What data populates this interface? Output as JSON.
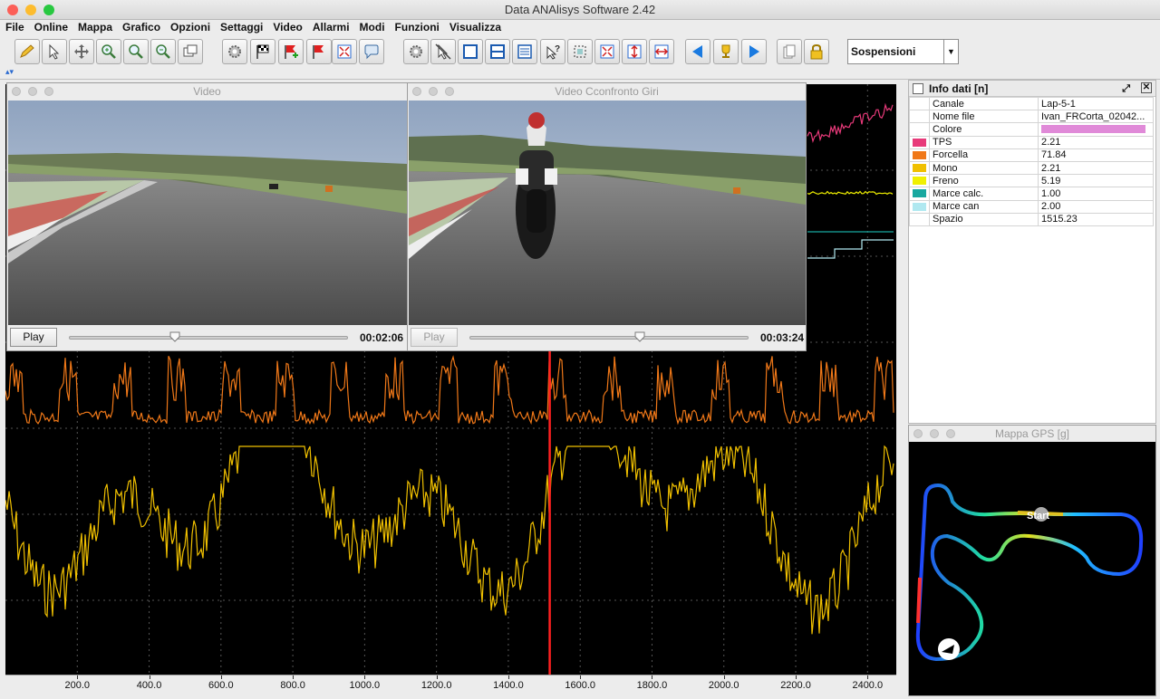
{
  "app": {
    "title": "Data ANAlisys Software 2.42"
  },
  "menu": [
    "File",
    "Online",
    "Mappa",
    "Grafico",
    "Opzioni",
    "Settaggi",
    "Video",
    "Allarmi",
    "Modi",
    "Funzioni",
    "Visualizza"
  ],
  "toolbar": {
    "buttons": [
      "pencil-icon",
      "pointer-icon",
      "move-icon",
      "zoom-in-icon",
      "zoom-icon",
      "zoom-out-icon",
      "window-icon",
      "gear-icon",
      "checkered-flag-icon",
      "flag-add-icon",
      "flag-icon",
      "fit-icon",
      "chat-icon",
      "settings-icon",
      "no-pointer-icon",
      "layout-single-icon",
      "layout-split-icon",
      "list-icon",
      "help-pointer-icon",
      "select-icon",
      "expand-icon",
      "vertical-expand-icon",
      "horizontal-expand-icon",
      "prev-icon",
      "trophy-icon",
      "next-icon",
      "copy-icon",
      "lock-icon"
    ],
    "combo_value": "Sospensioni"
  },
  "video1": {
    "title": "Video",
    "play": "Play",
    "time": "00:02:06",
    "progress": 0.38
  },
  "video2": {
    "title": "Video Cconfronto Giri",
    "play": "Play",
    "time": "00:03:24",
    "progress": 0.61
  },
  "info": {
    "title": "Info dati [n]",
    "rows": [
      {
        "label": "Canale",
        "value": "Lap-5-1",
        "color": ""
      },
      {
        "label": "Nome file",
        "value": "Ivan_FRCorta_02042...",
        "color": ""
      },
      {
        "label": "Colore",
        "value": "",
        "color": "",
        "swatch": "#e08ad8"
      },
      {
        "label": "TPS",
        "value": "2.21",
        "color": "#e83a7a"
      },
      {
        "label": "Forcella",
        "value": "71.84",
        "color": "#f07818"
      },
      {
        "label": "Mono",
        "value": "2.21",
        "color": "#f0c000"
      },
      {
        "label": "Freno",
        "value": "5.19",
        "color": "#f0f000"
      },
      {
        "label": "Marce calc.",
        "value": "1.00",
        "color": "#18a8a0"
      },
      {
        "label": "Marce can",
        "value": "2.00",
        "color": "#b0e8f0"
      },
      {
        "label": "Spazio",
        "value": "1515.23",
        "color": ""
      }
    ]
  },
  "gps": {
    "title": "Mappa GPS [g]",
    "start_label": "Start"
  },
  "xaxis": {
    "ticks": [
      "200.0",
      "400.0",
      "600.0",
      "800.0",
      "1000.0",
      "1200.0",
      "1400.0",
      "1600.0",
      "1800.0",
      "2000.0",
      "2200.0",
      "2400.0"
    ]
  },
  "cursor_x": 1515.23
}
